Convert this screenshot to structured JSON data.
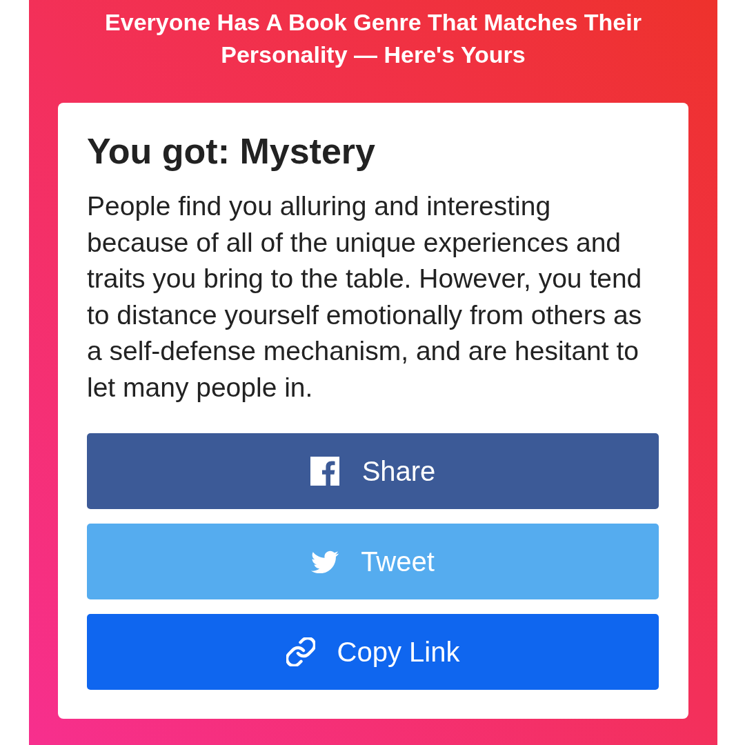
{
  "header": {
    "title": "Everyone Has A Book Genre That Matches Their Personality — Here's Yours"
  },
  "result": {
    "heading": "You got: Mystery",
    "description": "People find you alluring and interesting because of all of the unique experiences and traits you bring to the table. However, you tend to distance yourself emotionally from others as a self-defense mechanism, and are hesitant to let many people in."
  },
  "share_buttons": [
    {
      "kind": "facebook",
      "label": "Share"
    },
    {
      "kind": "twitter",
      "label": "Tweet"
    },
    {
      "kind": "link",
      "label": "Copy Link"
    }
  ]
}
